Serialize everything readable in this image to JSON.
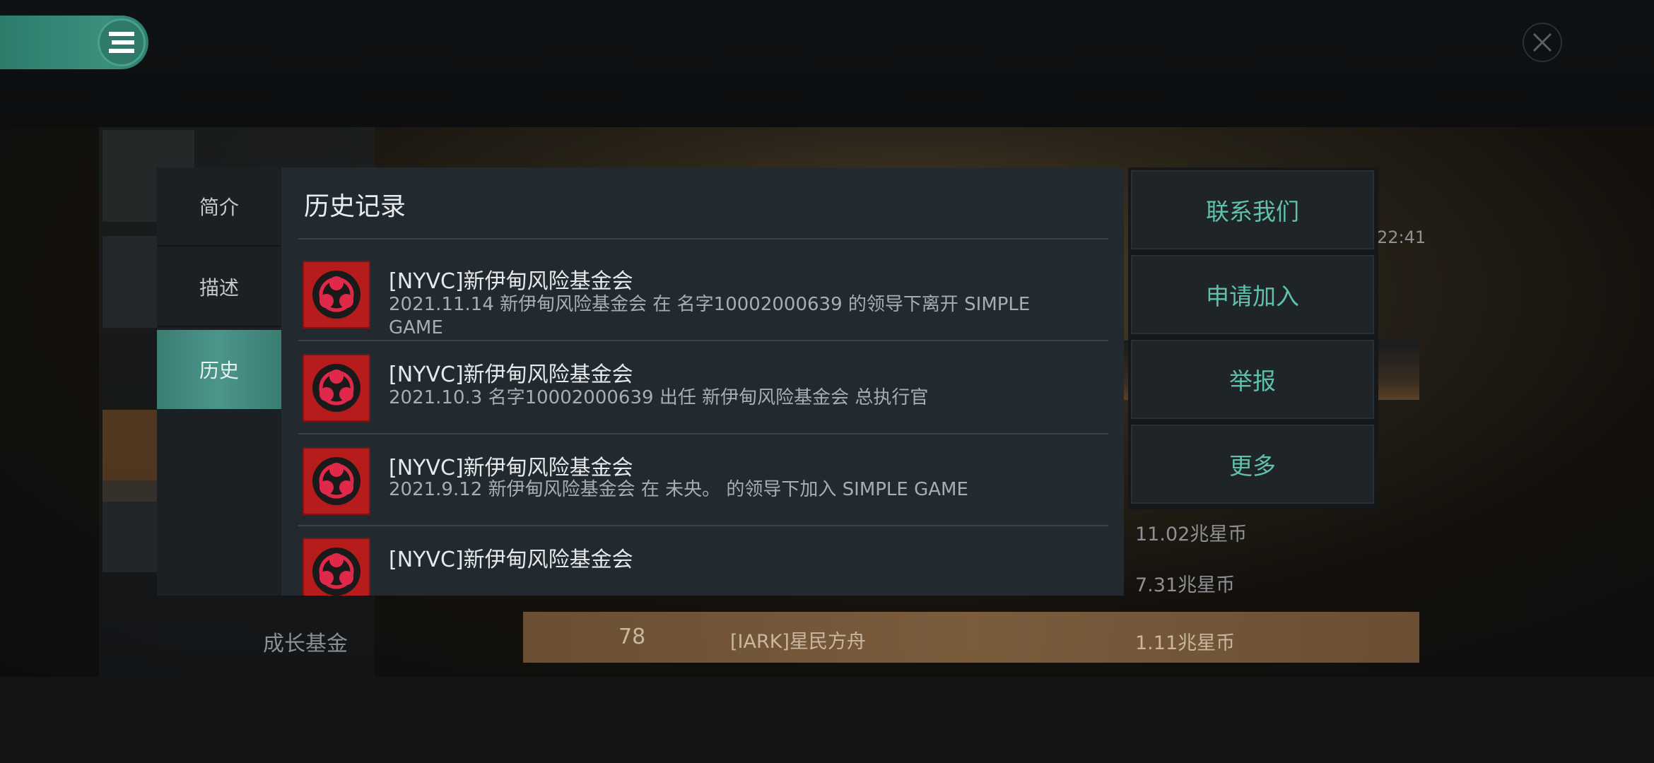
{
  "background": {
    "growth_fund_label": "成长基金",
    "time_fragment": "22:41",
    "amounts": [
      "11.02兆星币",
      "7.31兆星币"
    ],
    "highlight_row": {
      "rank": "78",
      "name": "[IARK]星民方舟",
      "amount": "1.11兆星币"
    }
  },
  "menu": {
    "icon": "menu-icon"
  },
  "close": {
    "icon": "close-icon"
  },
  "modal": {
    "nav": [
      {
        "label": "简介",
        "active": false
      },
      {
        "label": "描述",
        "active": false
      },
      {
        "label": "历史",
        "active": true
      }
    ],
    "title": "历史记录",
    "entries": [
      {
        "title": "[NYVC]新伊甸风险基金会",
        "desc": "2021.11.14   新伊甸风险基金会 在 名字10002000639 的领导下离开 SIMPLE GAME",
        "icon": "biohazard-icon"
      },
      {
        "title": "[NYVC]新伊甸风险基金会",
        "desc": "2021.10.3   名字10002000639 出任 新伊甸风险基金会 总执行官",
        "icon": "biohazard-icon"
      },
      {
        "title": "[NYVC]新伊甸风险基金会",
        "desc": "2021.9.12   新伊甸风险基金会 在 未央。 的领导下加入 SIMPLE GAME",
        "icon": "biohazard-icon"
      },
      {
        "title": "[NYVC]新伊甸风险基金会",
        "desc": "",
        "icon": "biohazard-icon"
      }
    ]
  },
  "actions": {
    "contact": "联系我们",
    "apply": "申请加入",
    "report": "举报",
    "more": "更多"
  },
  "colors": {
    "accent": "#5fc2a8",
    "nav_active": "#4c958a",
    "emblem_red": "#b71c1c"
  }
}
